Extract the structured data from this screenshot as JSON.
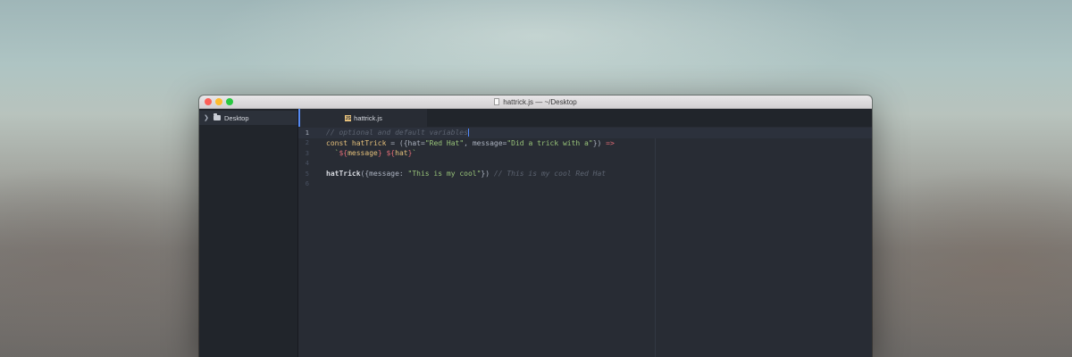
{
  "window": {
    "title": "hattrick.js — ~/Desktop"
  },
  "sidebar": {
    "root_label": "Desktop",
    "root_icon": "folder-icon"
  },
  "tabs": [
    {
      "label": "hattrick.js",
      "icon": "js-file-icon",
      "active": true
    }
  ],
  "editor": {
    "lines": [
      {
        "number": "1",
        "text": "// optional and default variables"
      },
      {
        "number": "2",
        "text": "const hatTrick = ({hat=\"Red Hat\", message=\"Did a trick with a\"}) =>"
      },
      {
        "number": "3",
        "text": "  `${message} ${hat}`"
      },
      {
        "number": "4",
        "text": ""
      },
      {
        "number": "5",
        "text": "hatTrick({message: \"This is my cool\"}) // This is my cool Red Hat"
      },
      {
        "number": "6",
        "text": ""
      }
    ],
    "tokens": {
      "l1_comment": "// optional and default variables",
      "l2_const": "const ",
      "l2_name": "hatTrick",
      "l2_eq": " = ",
      "l2_open": "({",
      "l2_hat": "hat",
      "l2_eq2": "=",
      "l2_hatval": "\"Red Hat\"",
      "l2_comma": ", ",
      "l2_msg": "message",
      "l2_eq3": "=",
      "l2_msgval": "\"Did a trick with a\"",
      "l2_close": "}) ",
      "l2_arrow": "=>",
      "l3_indent": "  ",
      "l3_tick1": "`",
      "l3_i1": "${",
      "l3_message": "message",
      "l3_i1c": "}",
      "l3_space": " ",
      "l3_i2": "${",
      "l3_hat": "hat",
      "l3_i2c": "}",
      "l3_tick2": "`",
      "l5_call": "hatTrick",
      "l5_open": "({",
      "l5_key": "message",
      "l5_colon": ": ",
      "l5_val": "\"This is my cool\"",
      "l5_close": "}) ",
      "l5_comment": "// This is my cool Red Hat"
    }
  },
  "colors": {
    "editor_bg": "#282c34",
    "sidebar_bg": "#21252b",
    "comment": "#5c6370",
    "keyword": "#e5c07b",
    "string": "#98c379",
    "operator": "#e06c75",
    "cursor": "#528bff"
  }
}
